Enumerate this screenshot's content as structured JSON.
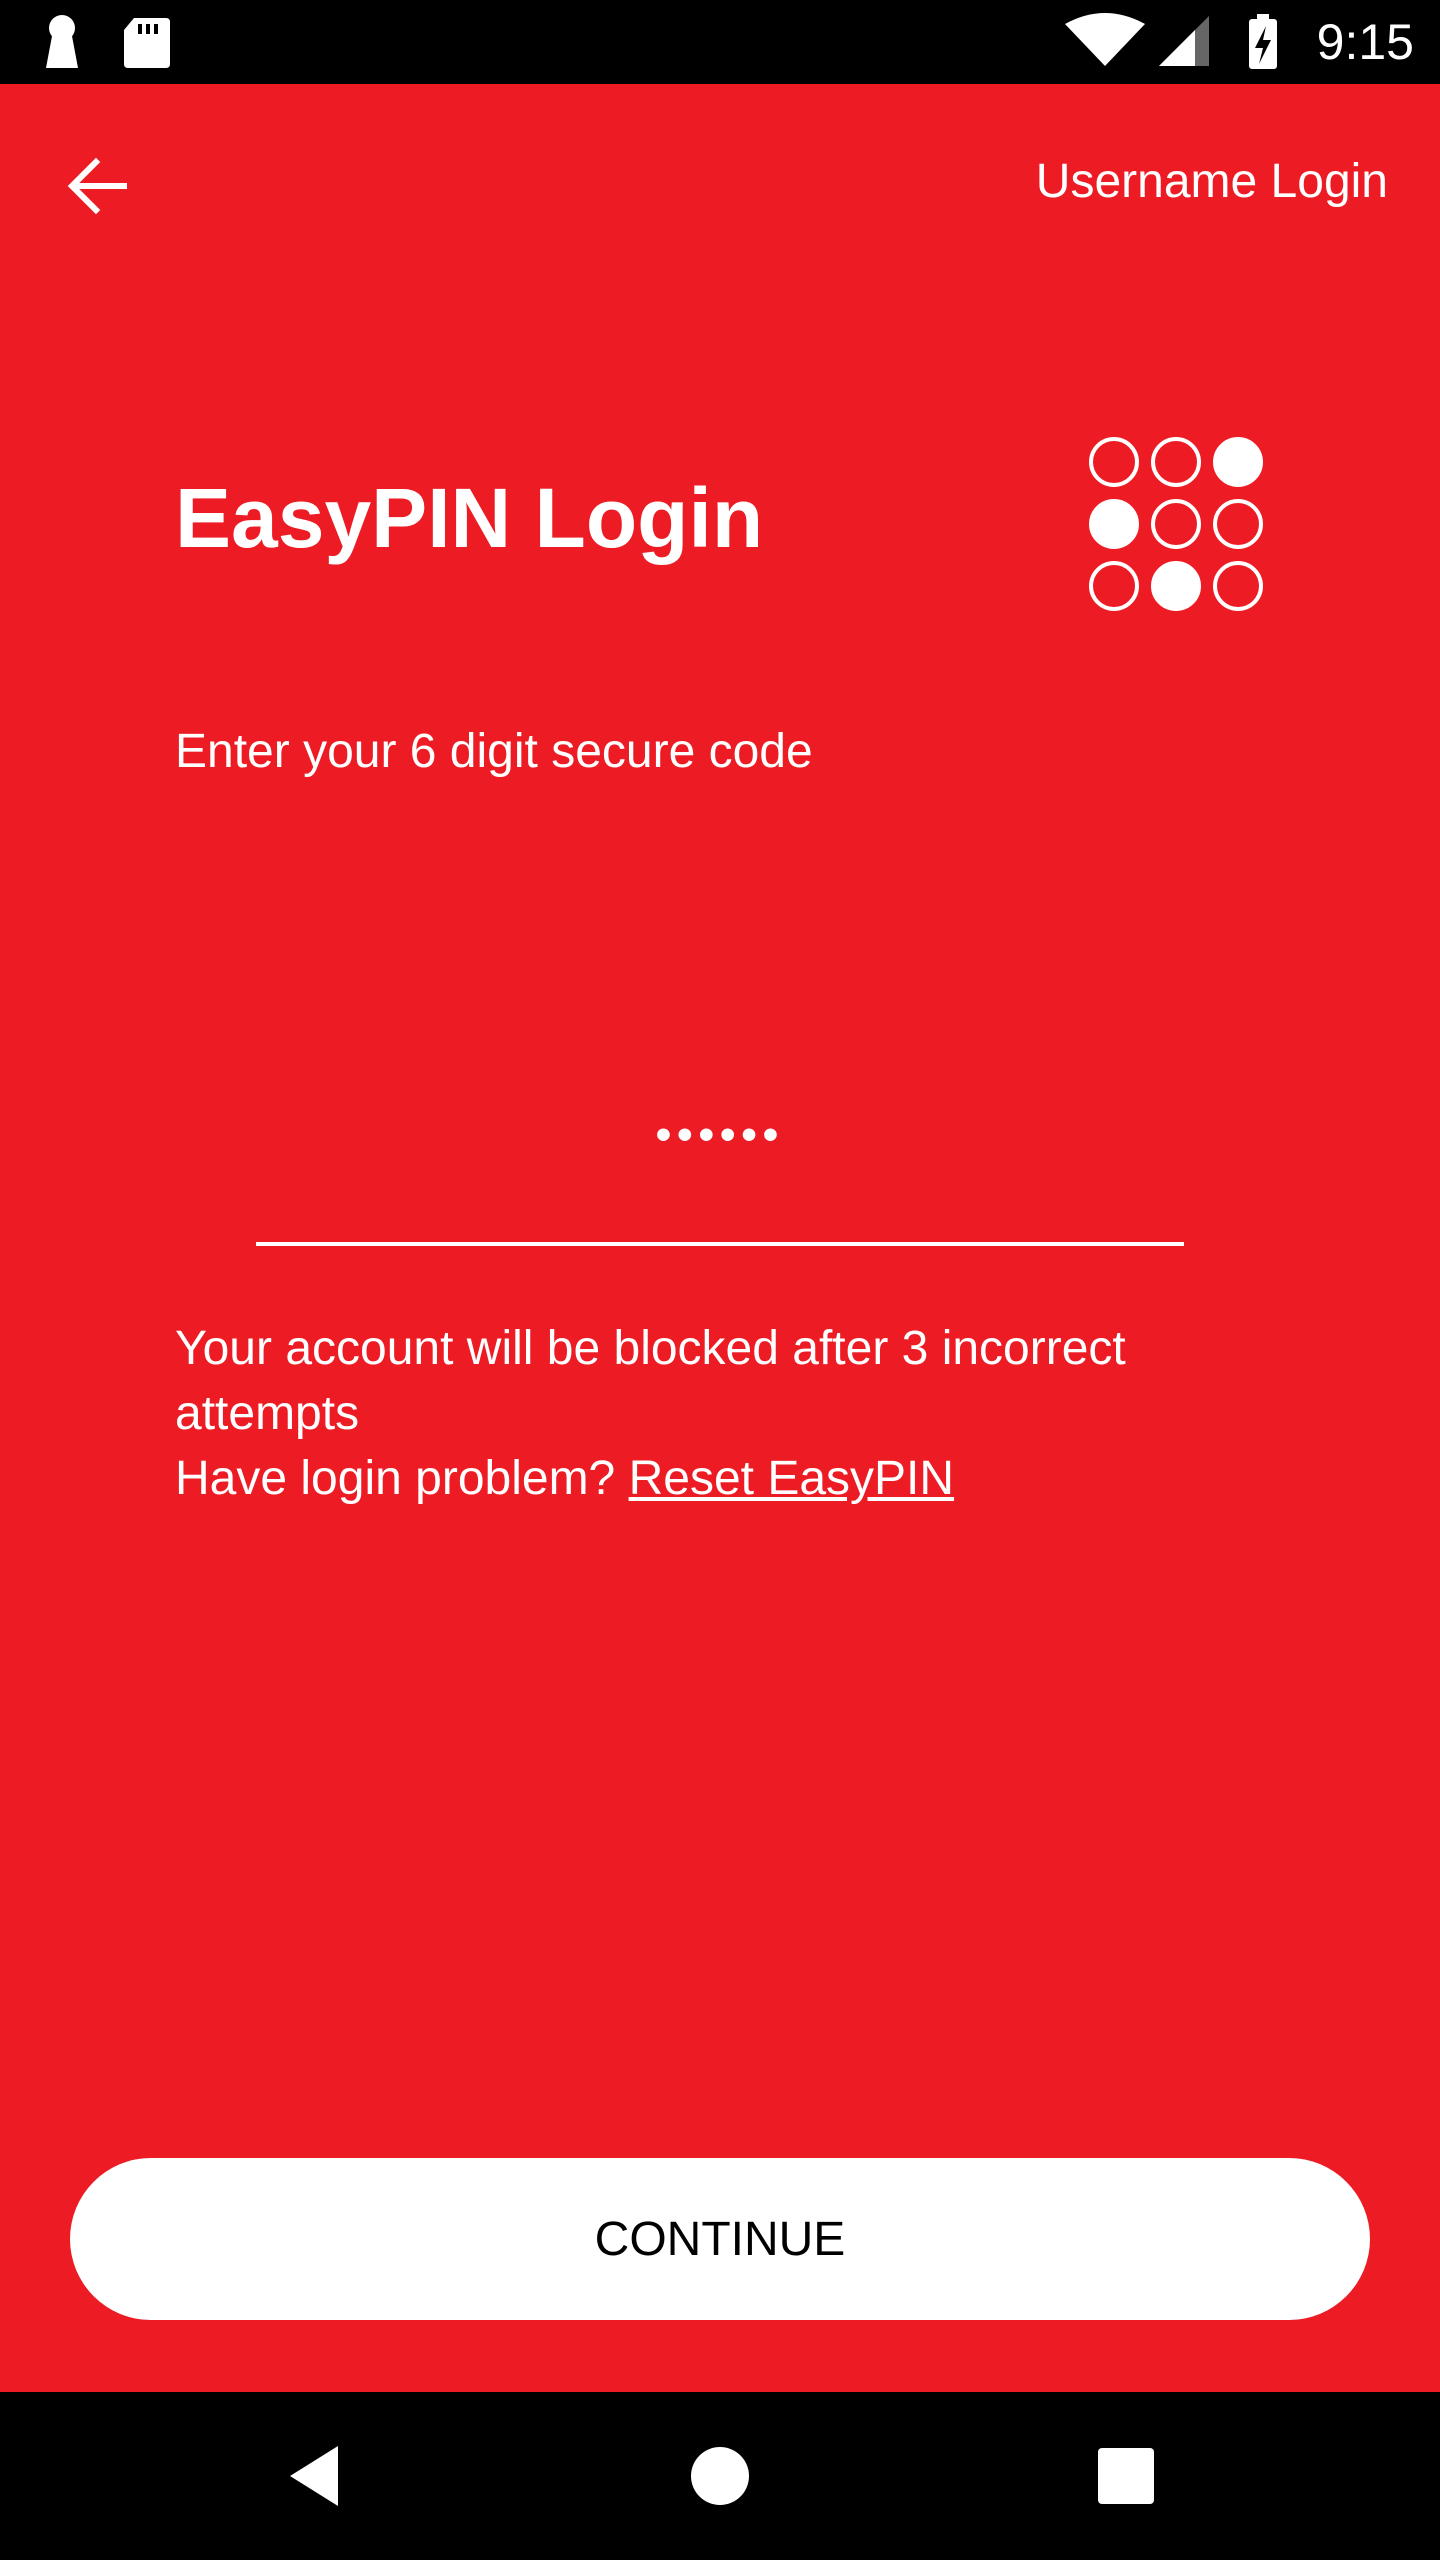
{
  "status_bar": {
    "time": "9:15",
    "left_icons": [
      "keyhole-icon",
      "sd-card-icon"
    ],
    "right_icons": [
      "wifi-icon",
      "signal-icon",
      "battery-charging-icon"
    ]
  },
  "top_bar": {
    "back_icon": "arrow-left-icon",
    "username_login_label": "Username Login"
  },
  "main": {
    "title": "EasyPIN Login",
    "pin_graphic_icon": "pin-grid-icon",
    "subtitle": "Enter your 6 digit secure code",
    "pin_value": "••••••",
    "warning_text": "Your account will be blocked after 3 incorrect attempts",
    "problem_text": "Have login problem?",
    "reset_link_label": "Reset EasyPIN"
  },
  "continue_label": "CONTINUE",
  "nav_bar": {
    "back_icon": "nav-back-icon",
    "home_icon": "nav-home-icon",
    "recents_icon": "nav-recents-icon"
  },
  "colors": {
    "background": "#ED1C24",
    "button": "#FFFFFF",
    "text": "#FFFFFF"
  }
}
